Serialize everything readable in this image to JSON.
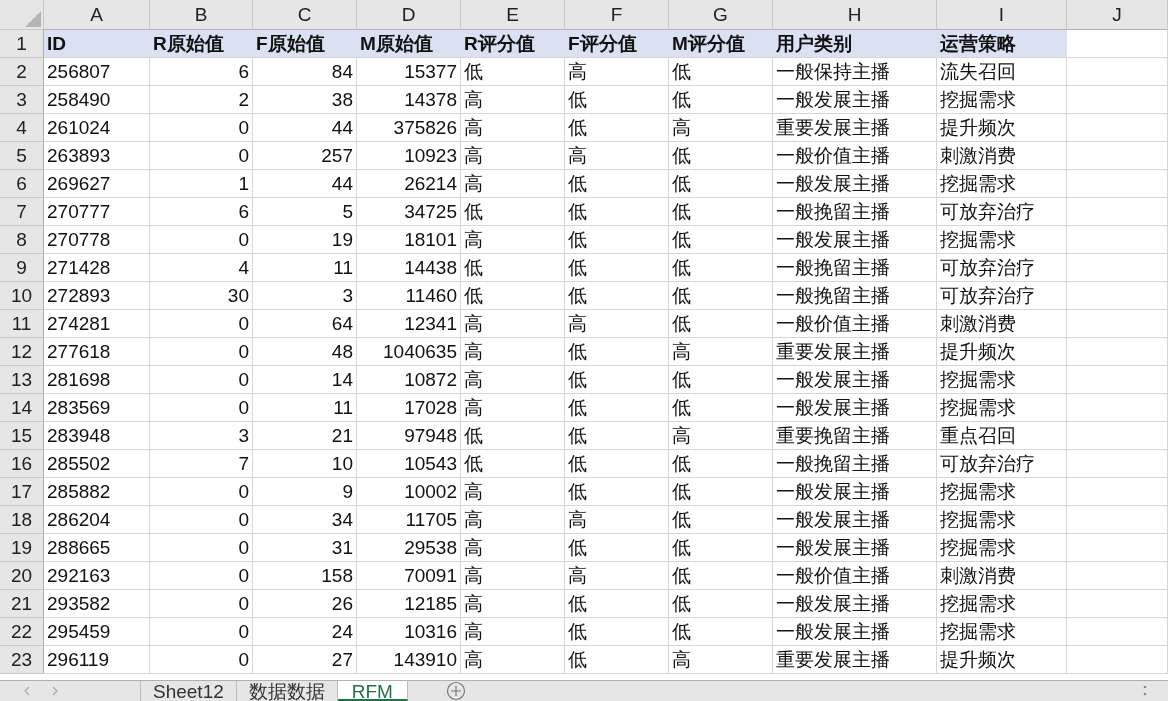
{
  "columns": [
    {
      "letter": "A",
      "kind": "text"
    },
    {
      "letter": "B",
      "kind": "number"
    },
    {
      "letter": "C",
      "kind": "number"
    },
    {
      "letter": "D",
      "kind": "number"
    },
    {
      "letter": "E",
      "kind": "text"
    },
    {
      "letter": "F",
      "kind": "text"
    },
    {
      "letter": "G",
      "kind": "text"
    },
    {
      "letter": "H",
      "kind": "text"
    },
    {
      "letter": "I",
      "kind": "text"
    },
    {
      "letter": "J"
    }
  ],
  "rows": [
    {
      "number": "1",
      "kind": "header",
      "cells": [
        "ID",
        "R原始值",
        "F原始值",
        "M原始值",
        "R评分值",
        "F评分值",
        "M评分值",
        "用户类别",
        "运营策略"
      ]
    },
    {
      "number": "2",
      "kind": "data",
      "cells": [
        "256807",
        "6",
        "84",
        "15377",
        "低",
        "高",
        "低",
        "一般保持主播",
        "流失召回"
      ]
    },
    {
      "number": "3",
      "kind": "data",
      "cells": [
        "258490",
        "2",
        "38",
        "14378",
        "高",
        "低",
        "低",
        "一般发展主播",
        "挖掘需求"
      ]
    },
    {
      "number": "4",
      "kind": "data",
      "cells": [
        "261024",
        "0",
        "44",
        "375826",
        "高",
        "低",
        "高",
        "重要发展主播",
        "提升频次"
      ]
    },
    {
      "number": "5",
      "kind": "data",
      "cells": [
        "263893",
        "0",
        "257",
        "10923",
        "高",
        "高",
        "低",
        "一般价值主播",
        "刺激消费"
      ]
    },
    {
      "number": "6",
      "kind": "data",
      "cells": [
        "269627",
        "1",
        "44",
        "26214",
        "高",
        "低",
        "低",
        "一般发展主播",
        "挖掘需求"
      ]
    },
    {
      "number": "7",
      "kind": "data",
      "cells": [
        "270777",
        "6",
        "5",
        "34725",
        "低",
        "低",
        "低",
        "一般挽留主播",
        "可放弃治疗"
      ]
    },
    {
      "number": "8",
      "kind": "data",
      "cells": [
        "270778",
        "0",
        "19",
        "18101",
        "高",
        "低",
        "低",
        "一般发展主播",
        "挖掘需求"
      ]
    },
    {
      "number": "9",
      "kind": "data",
      "cells": [
        "271428",
        "4",
        "11",
        "14438",
        "低",
        "低",
        "低",
        "一般挽留主播",
        "可放弃治疗"
      ]
    },
    {
      "number": "10",
      "kind": "data",
      "cells": [
        "272893",
        "30",
        "3",
        "11460",
        "低",
        "低",
        "低",
        "一般挽留主播",
        "可放弃治疗"
      ]
    },
    {
      "number": "11",
      "kind": "data",
      "cells": [
        "274281",
        "0",
        "64",
        "12341",
        "高",
        "高",
        "低",
        "一般价值主播",
        "刺激消费"
      ]
    },
    {
      "number": "12",
      "kind": "data",
      "cells": [
        "277618",
        "0",
        "48",
        "1040635",
        "高",
        "低",
        "高",
        "重要发展主播",
        "提升频次"
      ]
    },
    {
      "number": "13",
      "kind": "data",
      "cells": [
        "281698",
        "0",
        "14",
        "10872",
        "高",
        "低",
        "低",
        "一般发展主播",
        "挖掘需求"
      ]
    },
    {
      "number": "14",
      "kind": "data",
      "cells": [
        "283569",
        "0",
        "11",
        "17028",
        "高",
        "低",
        "低",
        "一般发展主播",
        "挖掘需求"
      ]
    },
    {
      "number": "15",
      "kind": "data",
      "cells": [
        "283948",
        "3",
        "21",
        "97948",
        "低",
        "低",
        "高",
        "重要挽留主播",
        "重点召回"
      ]
    },
    {
      "number": "16",
      "kind": "data",
      "cells": [
        "285502",
        "7",
        "10",
        "10543",
        "低",
        "低",
        "低",
        "一般挽留主播",
        "可放弃治疗"
      ]
    },
    {
      "number": "17",
      "kind": "data",
      "cells": [
        "285882",
        "0",
        "9",
        "10002",
        "高",
        "低",
        "低",
        "一般发展主播",
        "挖掘需求"
      ]
    },
    {
      "number": "18",
      "kind": "data",
      "cells": [
        "286204",
        "0",
        "34",
        "11705",
        "高",
        "高",
        "低",
        "一般发展主播",
        "挖掘需求"
      ]
    },
    {
      "number": "19",
      "kind": "data",
      "cells": [
        "288665",
        "0",
        "31",
        "29538",
        "高",
        "低",
        "低",
        "一般发展主播",
        "挖掘需求"
      ]
    },
    {
      "number": "20",
      "kind": "data",
      "cells": [
        "292163",
        "0",
        "158",
        "70091",
        "高",
        "高",
        "低",
        "一般价值主播",
        "刺激消费"
      ]
    },
    {
      "number": "21",
      "kind": "data",
      "cells": [
        "293582",
        "0",
        "26",
        "12185",
        "高",
        "低",
        "低",
        "一般发展主播",
        "挖掘需求"
      ]
    },
    {
      "number": "22",
      "kind": "data",
      "cells": [
        "295459",
        "0",
        "24",
        "10316",
        "高",
        "低",
        "低",
        "一般发展主播",
        "挖掘需求"
      ]
    },
    {
      "number": "23",
      "kind": "data",
      "cells": [
        "296119",
        "0",
        "27",
        "143910",
        "高",
        "低",
        "高",
        "重要发展主播",
        "提升频次"
      ]
    }
  ],
  "sheet_tabs": [
    {
      "label": "Sheet12",
      "selected": false
    },
    {
      "label": "数据数据",
      "selected": false
    },
    {
      "label": "RFM",
      "selected": true
    }
  ]
}
